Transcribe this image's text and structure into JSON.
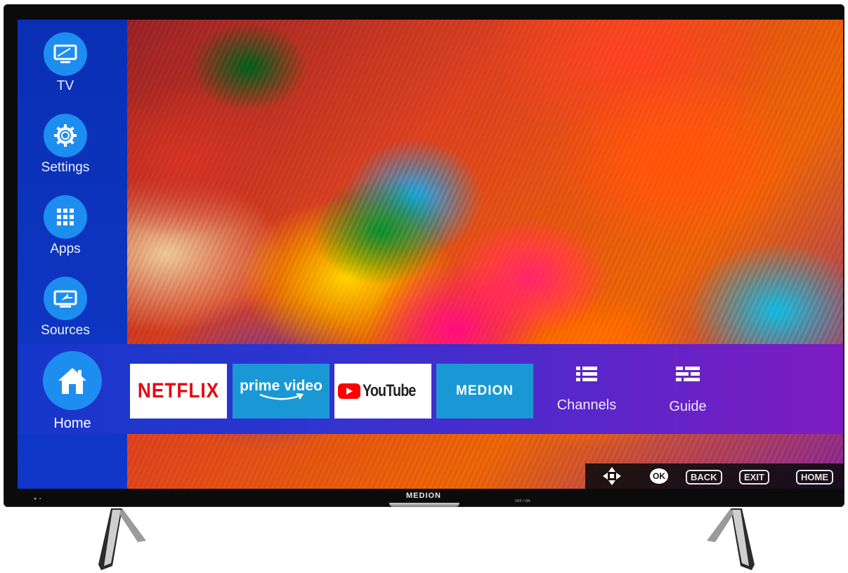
{
  "tv": {
    "brand": "MEDION",
    "power_label": "OFF / ON"
  },
  "sidebar": {
    "items": [
      {
        "label": "TV",
        "icon": "tv-icon"
      },
      {
        "label": "Settings",
        "icon": "settings-gear-icon"
      },
      {
        "label": "Apps",
        "icon": "apps-grid-icon"
      },
      {
        "label": "Sources",
        "icon": "sources-input-icon"
      }
    ]
  },
  "bottom_bar": {
    "home": {
      "label": "Home",
      "icon": "home-icon"
    },
    "apps": [
      {
        "label": "NETFLIX"
      },
      {
        "label": "prime video"
      },
      {
        "label": "YouTube"
      },
      {
        "label": "MEDION"
      }
    ],
    "channels": {
      "label": "Channels",
      "icon": "channels-list-icon"
    },
    "guide": {
      "label": "Guide",
      "icon": "guide-epg-icon"
    }
  },
  "remote_hints": {
    "ok": "OK",
    "back": "BACK",
    "exit": "EXIT",
    "home": "HOME"
  },
  "colors": {
    "sidebar": "#0d35c0",
    "accent_circle": "#1e8df0",
    "tile_blue": "#1a98d5",
    "netflix_red": "#e50914",
    "youtube_red": "#ff0000",
    "bar_end_purple": "#7e1cc2"
  }
}
